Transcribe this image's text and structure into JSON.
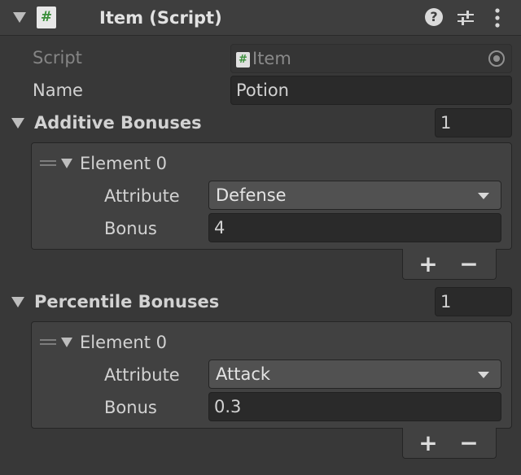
{
  "header": {
    "title": "Item (Script)",
    "icon": "script-icon",
    "script_glyph": "#"
  },
  "fields": {
    "script_label": "Script",
    "script_value": "Item",
    "name_label": "Name",
    "name_value": "Potion"
  },
  "additive": {
    "label": "Additive Bonuses",
    "size": "1",
    "element": {
      "label": "Element 0",
      "attribute_label": "Attribute",
      "attribute_value": "Defense",
      "bonus_label": "Bonus",
      "bonus_value": "4"
    },
    "add_label": "+",
    "remove_label": "−"
  },
  "percentile": {
    "label": "Percentile Bonuses",
    "size": "1",
    "element": {
      "label": "Element 0",
      "attribute_label": "Attribute",
      "attribute_value": "Attack",
      "bonus_label": "Bonus",
      "bonus_value": "0.3"
    },
    "add_label": "+",
    "remove_label": "−"
  }
}
